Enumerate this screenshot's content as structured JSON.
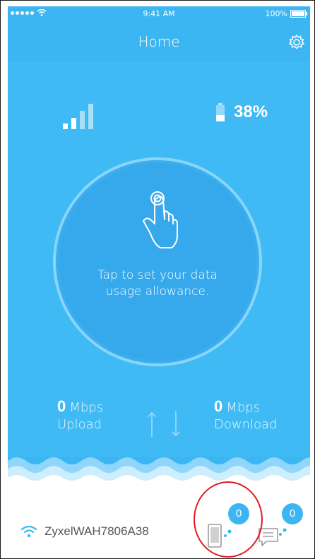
{
  "status_bar": {
    "time": "9:41 AM",
    "battery": "100%"
  },
  "header": {
    "title": "Home"
  },
  "indicators": {
    "battery_percent": "38%"
  },
  "dial": {
    "line1": "Tap to set your data",
    "line2": "usage allowance."
  },
  "upload": {
    "value": "0",
    "unit": "Mbps",
    "label": "Upload"
  },
  "download": {
    "value": "0",
    "unit": "Mbps",
    "label": "Download"
  },
  "network": {
    "ssid": "ZyxelWAH7806A38"
  },
  "badges": {
    "devices": "0",
    "messages": "0"
  },
  "colors": {
    "primary": "#3cb6f2",
    "highlight": "#e11b22"
  }
}
